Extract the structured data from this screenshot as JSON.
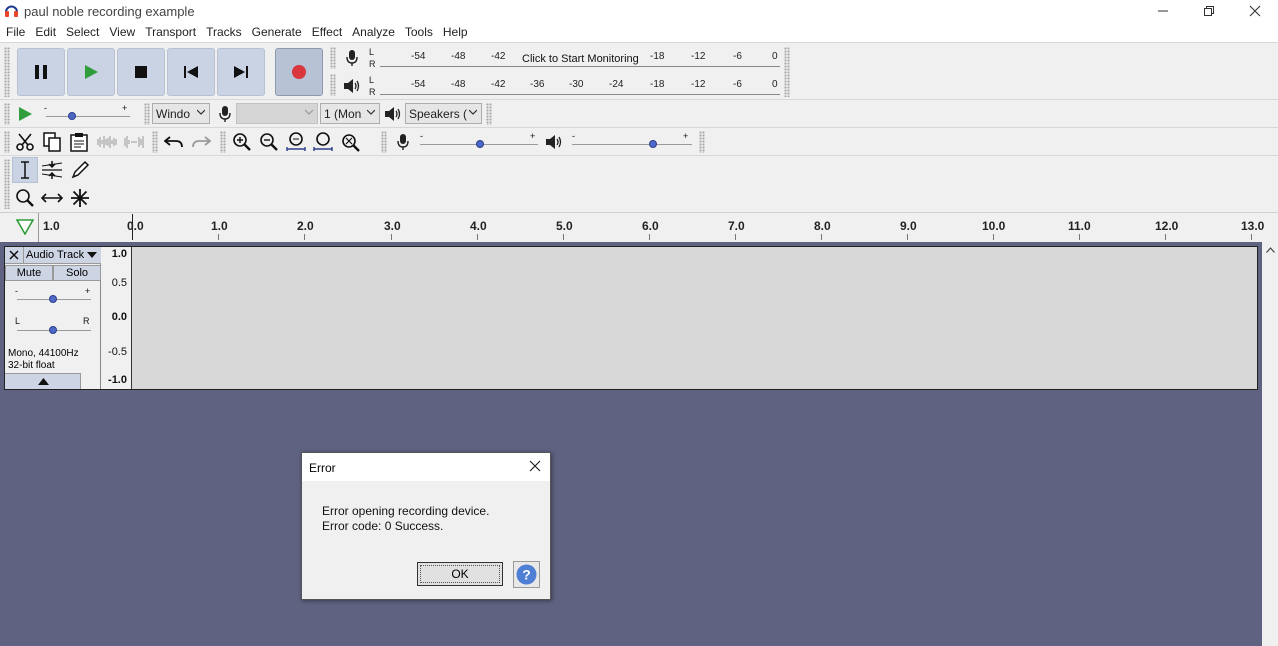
{
  "window": {
    "title": "paul noble recording example",
    "controls": [
      "minimize",
      "restore",
      "close"
    ]
  },
  "menu": [
    "File",
    "Edit",
    "Select",
    "View",
    "Transport",
    "Tracks",
    "Generate",
    "Effect",
    "Analyze",
    "Tools",
    "Help"
  ],
  "transport": {
    "buttons": [
      "pause-icon",
      "play-icon",
      "stop-icon",
      "skip-start-icon",
      "skip-end-icon",
      "record-icon"
    ],
    "record_color": "#d9363e"
  },
  "meters": {
    "record": {
      "lr": [
        "L",
        "R"
      ],
      "ticks_left": [
        "-54",
        "-48",
        "-42"
      ],
      "monitor_text": "Click to Start Monitoring",
      "ticks_right": [
        "-18",
        "-12",
        "-6",
        "0"
      ]
    },
    "playback": {
      "lr": [
        "L",
        "R"
      ],
      "ticks": [
        "-54",
        "-48",
        "-42",
        "-36",
        "-30",
        "-24",
        "-18",
        "-12",
        "-6",
        "0"
      ]
    }
  },
  "device_toolbar": {
    "host": "Windo",
    "recording_device": "",
    "channels": "1 (Mon",
    "playback_device": "Speakers ("
  },
  "play_at_speed": {
    "minus": "-",
    "plus": "+"
  },
  "mixer": {
    "rec_minus": "-",
    "rec_plus": "+",
    "play_minus": "-",
    "play_plus": "+"
  },
  "ruler": {
    "labels": [
      "1.0",
      "0.0",
      "1.0",
      "2.0",
      "3.0",
      "4.0",
      "5.0",
      "6.0",
      "7.0",
      "8.0",
      "9.0",
      "10.0",
      "11.0",
      "12.0",
      "13.0"
    ]
  },
  "track": {
    "name": "Audio Track",
    "mute": "Mute",
    "solo": "Solo",
    "gain_minus": "-",
    "gain_plus": "+",
    "pan_left": "L",
    "pan_right": "R",
    "info_line1": "Mono, 44100Hz",
    "info_line2": "32-bit float",
    "scale": [
      "1.0",
      "0.5",
      "0.0",
      "-0.5",
      "-1.0"
    ]
  },
  "dialog": {
    "title": "Error",
    "message_line1": "Error opening recording device.",
    "message_line2": "Error code: 0 Success.",
    "ok_label": "OK"
  }
}
